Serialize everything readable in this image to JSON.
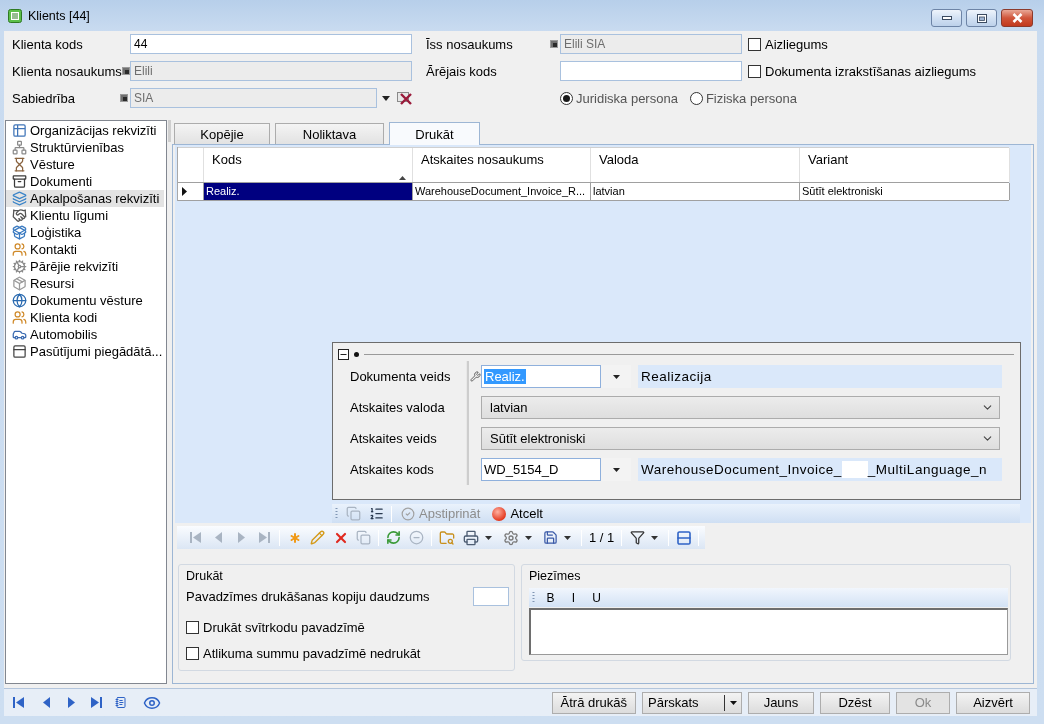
{
  "window": {
    "title": "Klients [44]"
  },
  "header": {
    "left_fields": [
      {
        "label": "Klienta kods",
        "value": "44",
        "disabled": false,
        "kind": "text"
      },
      {
        "label": "Klienta nosaukums",
        "value": "Elili",
        "disabled": true,
        "kind": "text"
      },
      {
        "label": "Sabiedrība",
        "value": "SIA",
        "disabled": true,
        "kind": "lookup"
      }
    ],
    "right_fields": [
      {
        "label": "Īss nosaukums",
        "value": "Elili SIA",
        "disabled": true
      },
      {
        "label": "Ārējais kods",
        "disabled": false
      }
    ],
    "checkboxes": [
      {
        "label": "Aizliegums",
        "checked": false
      },
      {
        "label": "Dokumenta izrakstīšanas aizliegums",
        "checked": false
      }
    ],
    "person_type": [
      {
        "label": "Juridiska persona",
        "selected": true
      },
      {
        "label": "Fiziska persona",
        "selected": false
      }
    ]
  },
  "sidebar": {
    "items": [
      {
        "label": "Organizācijas rekvizīti",
        "selected": false
      },
      {
        "label": "Struktūrvienības",
        "selected": false
      },
      {
        "label": "Vēsture",
        "selected": false
      },
      {
        "label": "Dokumenti",
        "selected": false
      },
      {
        "label": "Apkalpošanas rekvizīti",
        "selected": true
      },
      {
        "label": "Klientu līgumi",
        "selected": false
      },
      {
        "label": "Loģistika",
        "selected": false
      },
      {
        "label": "Kontakti",
        "selected": false
      },
      {
        "label": "Pārējie rekvizīti",
        "selected": false
      },
      {
        "label": "Resursi",
        "selected": false
      },
      {
        "label": "Dokumentu vēsture",
        "selected": false
      },
      {
        "label": "Klienta kodi",
        "selected": false
      },
      {
        "label": "Automobilis",
        "selected": false
      },
      {
        "label": "Pasūtījumi piegādātā...",
        "selected": false
      }
    ]
  },
  "tabs": [
    {
      "label": "Kopējie",
      "selected": false
    },
    {
      "label": "Noliktava",
      "selected": false
    },
    {
      "label": "Drukāt",
      "selected": true
    }
  ],
  "grid": {
    "columns": [
      {
        "label": "Kods",
        "sorted": true
      },
      {
        "label": "Atskaites nosaukums",
        "sorted": false
      },
      {
        "label": "Valoda",
        "sorted": false
      },
      {
        "label": "Variant",
        "sorted": false
      }
    ],
    "rows": [
      {
        "current": true,
        "cells": [
          {
            "text": "Realiz.",
            "selected": true
          },
          {
            "text": "WarehouseDocument_Invoice_R...",
            "selected": false
          },
          {
            "text": "latvian",
            "selected": false
          },
          {
            "text": "Sūtīt elektroniski",
            "selected": false
          }
        ]
      }
    ]
  },
  "detail": {
    "expanded": true,
    "rows": [
      {
        "kind": "lookup",
        "label": "Dokumenta veids",
        "code": "Realiz.",
        "focused": true,
        "description": "Realizacija"
      },
      {
        "kind": "select",
        "label": "Atskaites valoda",
        "value": "latvian"
      },
      {
        "kind": "select",
        "label": "Atskaites veids",
        "value": "Sūtīt elektroniski"
      },
      {
        "kind": "lookup",
        "label": "Atskaites kods",
        "code": "WD_5154_D",
        "focused": false,
        "description": "WarehouseDocument_Invoice_",
        "description_end": "_MultiLanguage_n"
      }
    ]
  },
  "detail_toolbar": [
    {
      "kind": "copy",
      "disabled": true
    },
    {
      "kind": "numbering",
      "disabled": false
    },
    {
      "kind": "separator"
    },
    {
      "kind": "confirm",
      "label": "Apstiprināt",
      "disabled": true
    },
    {
      "kind": "cancel",
      "label": "Atcelt",
      "disabled": false
    }
  ],
  "grid_toolbar": [
    {
      "kind": "first",
      "disabled": true,
      "dropdown": false
    },
    {
      "kind": "previous",
      "disabled": true,
      "dropdown": false
    },
    {
      "kind": "next",
      "disabled": true,
      "dropdown": false
    },
    {
      "kind": "last",
      "disabled": true,
      "dropdown": false
    },
    {
      "kind": "separator"
    },
    {
      "kind": "new",
      "disabled": false,
      "dropdown": false
    },
    {
      "kind": "edit",
      "disabled": false,
      "dropdown": false
    },
    {
      "kind": "delete",
      "disabled": false,
      "dropdown": false
    },
    {
      "kind": "copy",
      "disabled": true,
      "dropdown": false
    },
    {
      "kind": "separator"
    },
    {
      "kind": "refresh",
      "disabled": false,
      "dropdown": false
    },
    {
      "kind": "stop",
      "disabled": true,
      "dropdown": false
    },
    {
      "kind": "separator"
    },
    {
      "kind": "find",
      "disabled": false,
      "dropdown": false
    },
    {
      "kind": "print",
      "disabled": false,
      "dropdown": true
    },
    {
      "kind": "settings",
      "disabled": false,
      "dropdown": true
    },
    {
      "kind": "save",
      "disabled": false,
      "dropdown": true
    },
    {
      "kind": "separator"
    },
    {
      "kind": "counter",
      "label": "1 / 1"
    },
    {
      "kind": "separator"
    },
    {
      "kind": "filter",
      "disabled": false,
      "dropdown": true
    },
    {
      "kind": "separator"
    },
    {
      "kind": "layout",
      "disabled": false,
      "dropdown": false
    },
    {
      "kind": "separator"
    }
  ],
  "print_settings": {
    "title": "Drukāt",
    "copies_label": "Pavadzīmes drukāšanas kopiju daudzums",
    "checkboxes": [
      {
        "label": "Drukāt svītrkodu pavadzīmē",
        "checked": false
      },
      {
        "label": "Atlikuma summu pavadzīmē nedrukāt",
        "checked": false
      }
    ]
  },
  "notes": {
    "title": "Piezīmes",
    "format_buttons": [
      "B",
      "I",
      "U"
    ]
  },
  "bottom_bar": {
    "buttons": [
      {
        "label": "Ātrā drukāš",
        "kind": "button",
        "disabled": false
      },
      {
        "label": "Pārskats",
        "kind": "split",
        "disabled": false
      },
      {
        "label": "Jauns",
        "kind": "button",
        "disabled": false
      },
      {
        "label": "Dzēst",
        "kind": "button",
        "disabled": false
      },
      {
        "label": "Ok",
        "kind": "button",
        "disabled": true
      },
      {
        "label": "Aizvērt",
        "kind": "button",
        "disabled": false
      }
    ]
  }
}
